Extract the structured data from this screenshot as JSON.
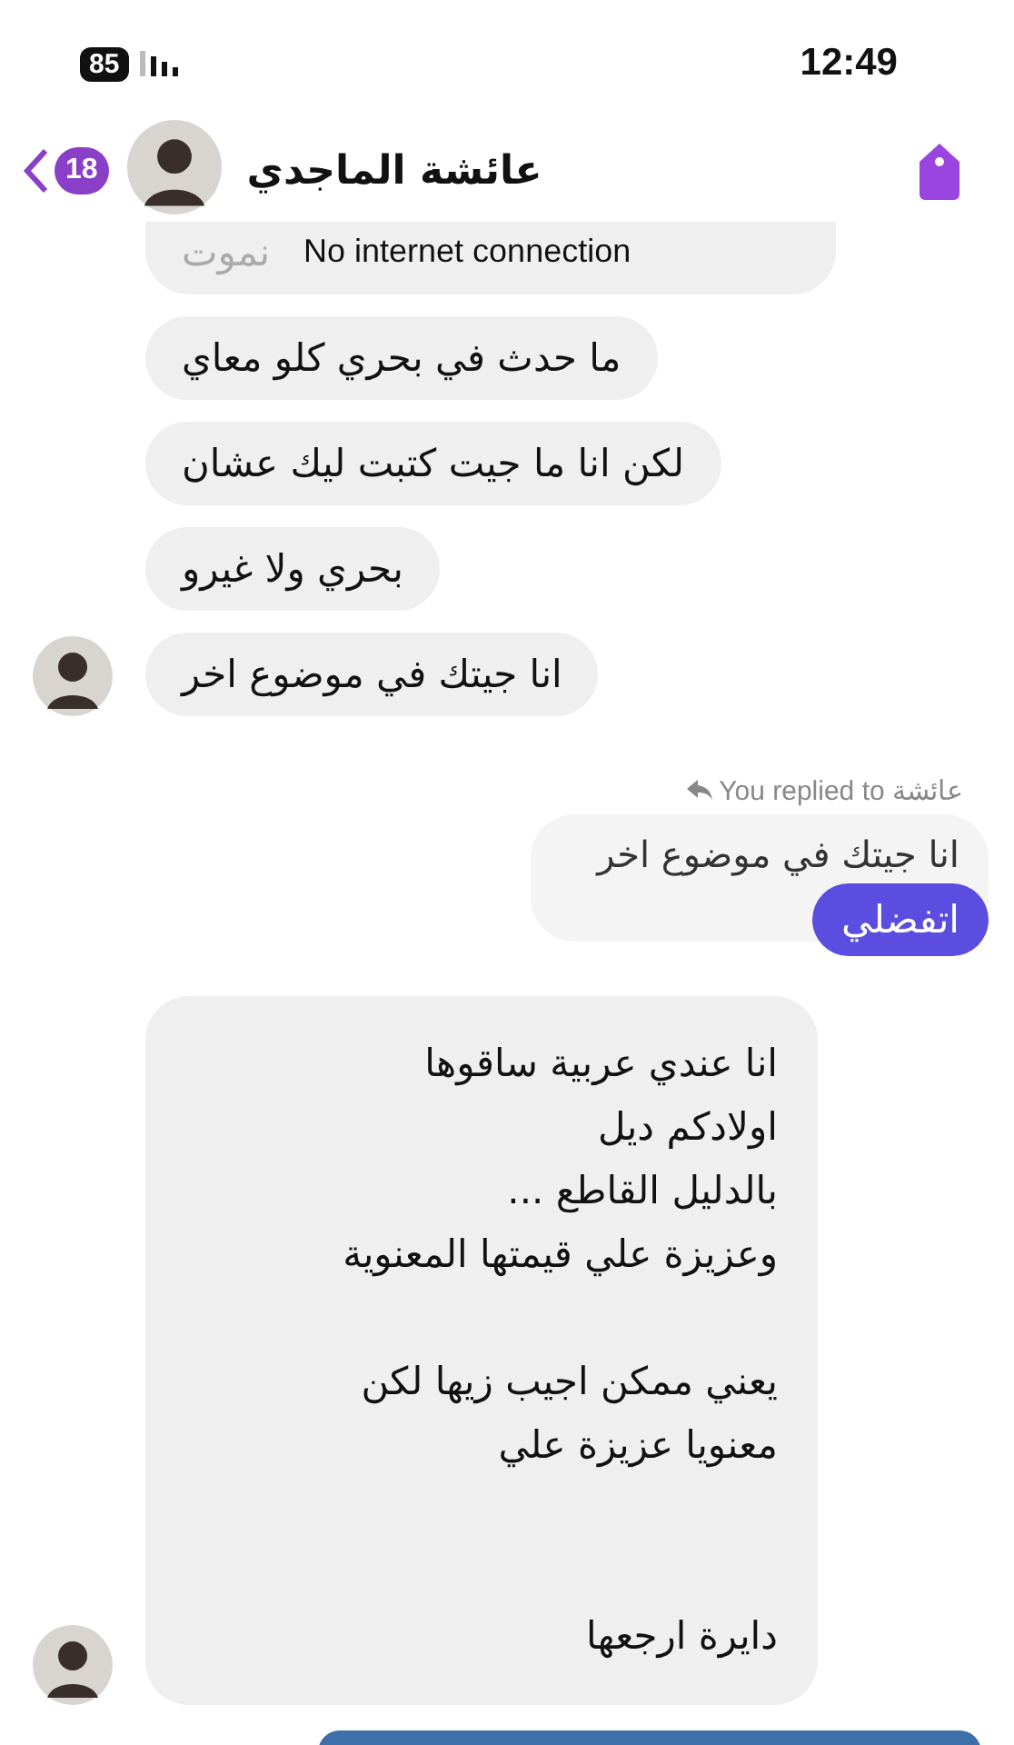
{
  "status_bar": {
    "battery": "85",
    "time": "12:49"
  },
  "header": {
    "unread_count": "18",
    "name": "عائشة الماجدي"
  },
  "toast": "No internet connection",
  "messages": [
    {
      "kind": "received",
      "avatar": false,
      "text": "نموت"
    },
    {
      "kind": "received",
      "avatar": false,
      "text": "ما حدث في بحري كلو معاي"
    },
    {
      "kind": "received",
      "avatar": false,
      "text": "لكن انا ما جيت كتبت ليك عشان"
    },
    {
      "kind": "received",
      "avatar": false,
      "text": "بحري ولا غيرو"
    },
    {
      "kind": "received",
      "avatar": true,
      "text": "انا جيتك في موضوع اخر"
    },
    {
      "kind": "reply",
      "label": "You replied to عائشة",
      "text": "انا جيتك في موضوع اخر"
    },
    {
      "kind": "sent",
      "text": "اتفضلي"
    },
    {
      "kind": "received",
      "avatar": true,
      "text": "انا عندي عربية ساقوها\nاولادكم ديل\nبالدليل القاطع ...\nوعزيزة علي قيمتها المعنوية\n\nيعني ممكن اجيب زيها لكن\nمعنويا عزيزة علي\n\n\nدايرة ارجعها"
    },
    {
      "kind": "sent_cut"
    }
  ]
}
